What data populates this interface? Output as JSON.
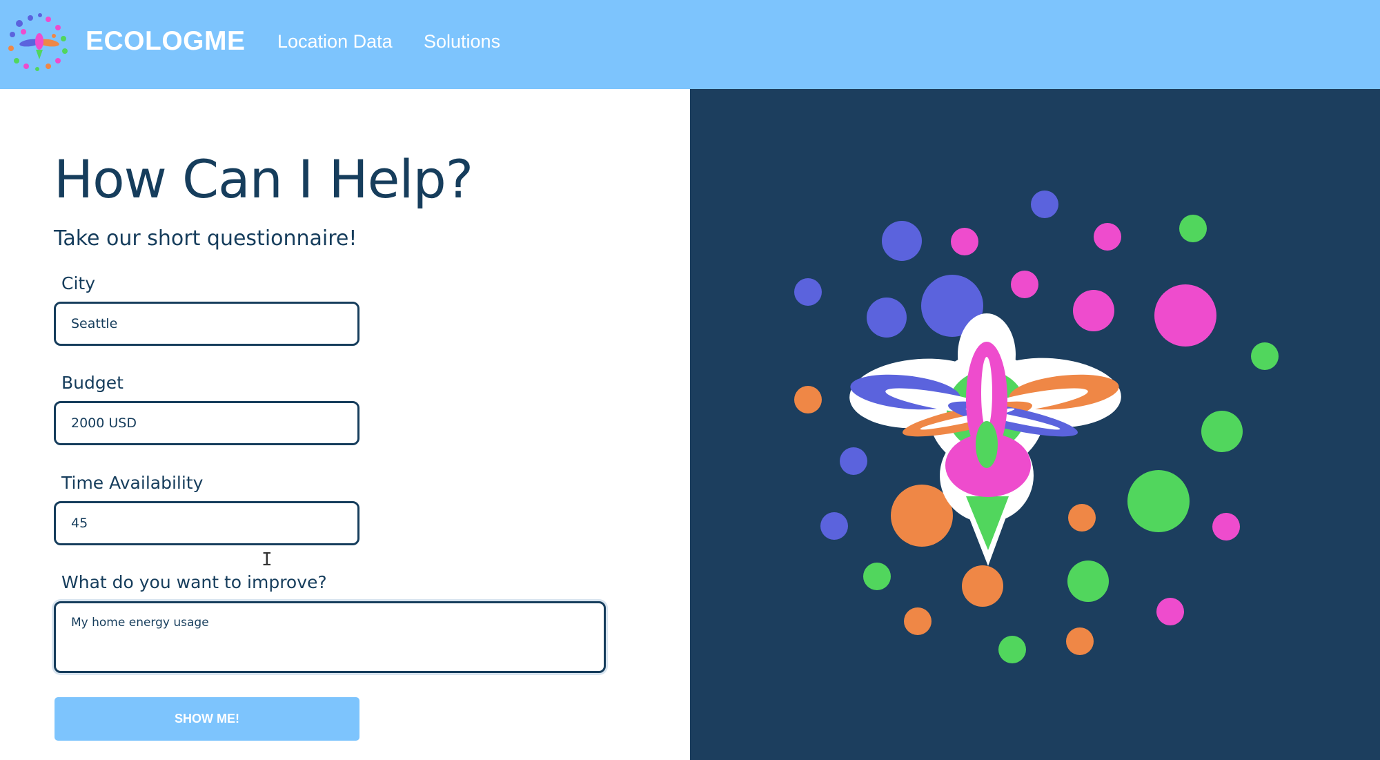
{
  "header": {
    "brand": "ECOLOGME",
    "nav": [
      {
        "label": "Location Data"
      },
      {
        "label": "Solutions"
      }
    ]
  },
  "main": {
    "title": "How Can I Help?",
    "subtitle": "Take our short questionnaire!",
    "form": {
      "city": {
        "label": "City",
        "value": "Seattle"
      },
      "budget": {
        "label": "Budget",
        "value": "2000 USD"
      },
      "time": {
        "label": "Time Availability",
        "value": "45"
      },
      "improve": {
        "label": "What do you want to improve?",
        "value": "My home energy usage"
      },
      "submit_label": "SHOW ME!"
    }
  },
  "colors": {
    "header_bg": "#7dc4fd",
    "dark_navy": "#1c3e5e",
    "text_navy": "#163d5c",
    "blue": "#5b63dd",
    "pink": "#ee4ccd",
    "green": "#51d65d",
    "orange": "#ef8746"
  },
  "icons": {
    "logo": "ecology-flower-logo-icon",
    "hero": "ecology-flower-illustration",
    "cursor": "text-cursor-icon"
  }
}
